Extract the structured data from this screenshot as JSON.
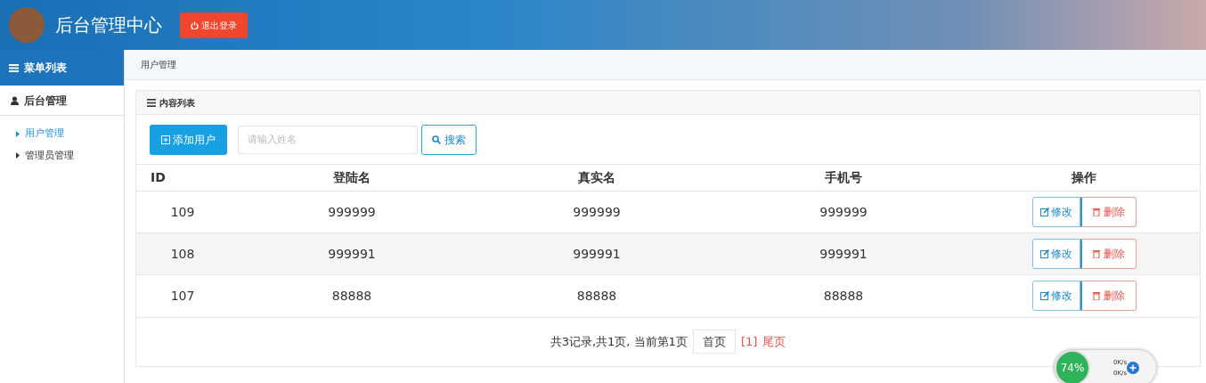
{
  "header": {
    "title": "后台管理中心",
    "logout_button": "退出登录"
  },
  "sidebar": {
    "heading": "菜单列表",
    "group": "后台管理",
    "items": [
      {
        "label": "用户管理",
        "selected": true
      },
      {
        "label": "管理员管理",
        "selected": false
      }
    ]
  },
  "breadcrumb": "用户管理",
  "panel": {
    "title": "内容列表",
    "add_button": "添加用户",
    "search": {
      "placeholder": "请输入姓名"
    },
    "search_button": "搜索"
  },
  "table": {
    "columns": [
      "ID",
      "登陆名",
      "真实名",
      "手机号",
      "操作"
    ],
    "rows": [
      {
        "cells": [
          "109",
          "999999",
          "999999",
          "999999"
        ],
        "actions": [
          "修改",
          "删除"
        ]
      },
      {
        "cells": [
          "108",
          "999991",
          "999991",
          "999991"
        ],
        "actions": [
          "修改",
          "删除"
        ]
      },
      {
        "cells": [
          "107",
          "88888",
          "88888",
          "88888"
        ],
        "actions": [
          "修改",
          "删除"
        ]
      }
    ]
  },
  "pagination": {
    "summary": "共3记录,共1页, 当前第1页",
    "first": "首页",
    "current": "[1]",
    "last": "尾页"
  },
  "net_widget": {
    "percent": "74%",
    "upload": "0K/s",
    "download": "0K/s"
  }
}
